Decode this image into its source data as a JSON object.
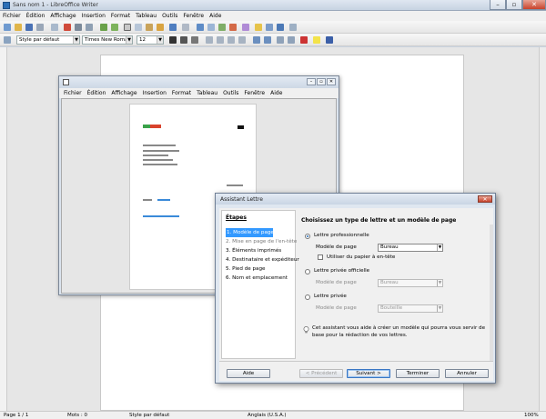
{
  "window": {
    "title": "Sans nom 1 - LibreOffice Writer"
  },
  "menu": [
    "Fichier",
    "Édition",
    "Affichage",
    "Insertion",
    "Format",
    "Tableau",
    "Outils",
    "Fenêtre",
    "Aide"
  ],
  "format_bar": {
    "style": "Style par défaut",
    "font": "Times New Roman",
    "size": "12"
  },
  "preview_window": {
    "menu": [
      "Fichier",
      "Édition",
      "Affichage",
      "Insertion",
      "Format",
      "Tableau",
      "Outils",
      "Fenêtre",
      "Aide"
    ]
  },
  "wizard": {
    "title": "Assistant Lettre",
    "steps_heading": "Étapes",
    "steps": [
      "1. Modèle de page",
      "2. Mise en page de l'en-tête",
      "3. Éléments imprimés",
      "4. Destinataire et expéditeur",
      "5. Pied de page",
      "6. Nom et emplacement"
    ],
    "active_step": 0,
    "content_heading": "Choisissez un type de lettre et un modèle de page",
    "professional": {
      "label": "Lettre professionnelle",
      "layout_label": "Modèle de page",
      "layout_value": "Bureau",
      "letterhead_label": "Utiliser du papier à en-tête"
    },
    "formal": {
      "label": "Lettre privée officielle",
      "layout_label": "Modèle de page",
      "layout_value": "Bureau"
    },
    "personal": {
      "label": "Lettre privée",
      "layout_label": "Modèle de page",
      "layout_value": "Bouteille"
    },
    "hint": "Cet assistant vous aide à créer un modèle qui pourra vous servir de base pour la rédaction de vos lettres.",
    "buttons": {
      "help": "Aide",
      "back": "< Précédent",
      "next": "Suivant >",
      "finish": "Terminer",
      "cancel": "Annuler"
    }
  },
  "status": {
    "page": "Page 1 / 1",
    "words": "Mots : 0",
    "style": "Style par défaut",
    "language": "Anglais (U.S.A.)",
    "zoom": "100%"
  }
}
